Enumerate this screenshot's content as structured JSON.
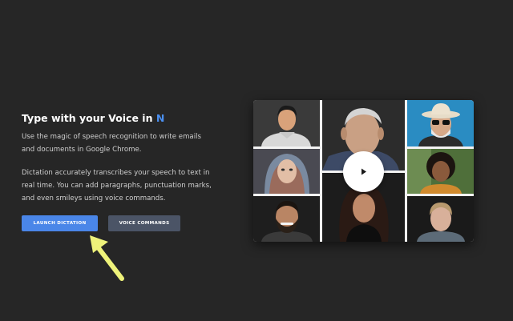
{
  "hero": {
    "headline": "Type with your Voice in",
    "headline_accent": "N",
    "paragraph_1": "Use the magic of speech recognition to write emails and documents in Google Chrome.",
    "paragraph_2": "Dictation accurately transcribes your speech to text in real time. You can add paragraphs, punctuation marks, and even smileys using voice commands."
  },
  "buttons": {
    "launch": "LAUNCH DICTATION",
    "voice_commands": "VOICE COMMANDS"
  },
  "video": {
    "play_icon": "play-icon",
    "tiles": [
      "young-man-portrait",
      "elderly-man-portrait",
      "man-with-hat-sunglasses-portrait",
      "woman-with-headscarf-portrait",
      "woman-curly-hair-portrait",
      "woman-long-hair-portrait",
      "bearded-man-portrait",
      "young-man-blond-portrait"
    ]
  },
  "colors": {
    "background": "#262626",
    "accent": "#4a8ff0",
    "launch_button": "#4a86e8",
    "voice_button": "#4b5466",
    "arrow": "#eef27a"
  }
}
